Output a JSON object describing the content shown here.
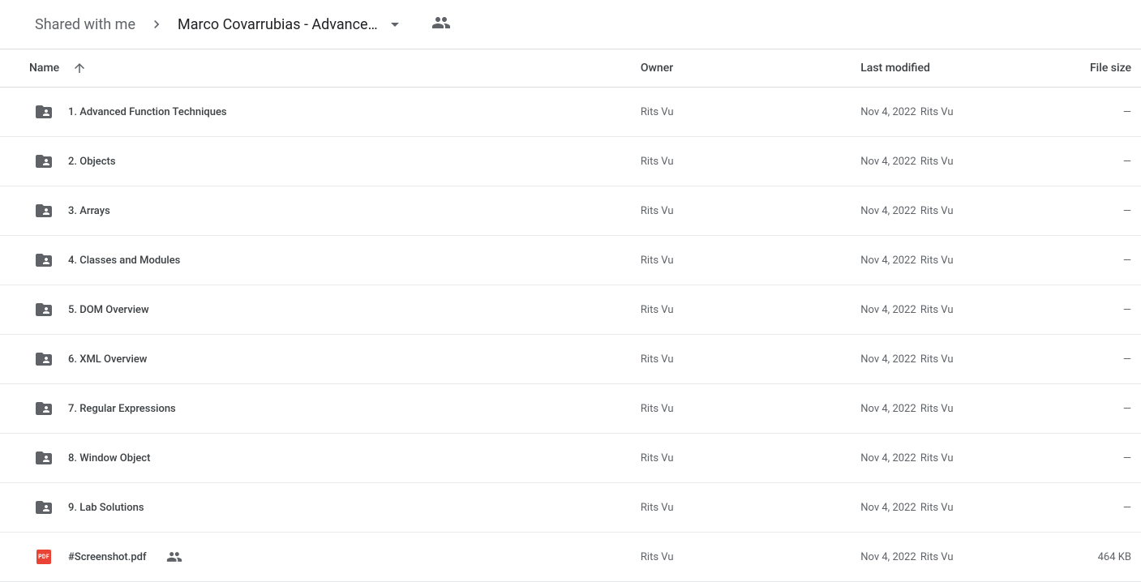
{
  "breadcrumb": {
    "root": "Shared with me",
    "current": "Marco Covarrubias - Advance…"
  },
  "columns": {
    "name": "Name",
    "owner": "Owner",
    "modified": "Last modified",
    "size": "File size"
  },
  "rows": [
    {
      "type": "folder-shared",
      "name": "1. Advanced Function Techniques",
      "owner": "Rits Vu",
      "modified_date": "Nov 4, 2022",
      "modified_by": "Rits Vu",
      "size": "—",
      "shared_badge": false
    },
    {
      "type": "folder-shared",
      "name": "2. Objects",
      "owner": "Rits Vu",
      "modified_date": "Nov 4, 2022",
      "modified_by": "Rits Vu",
      "size": "—",
      "shared_badge": false
    },
    {
      "type": "folder-shared",
      "name": "3. Arrays",
      "owner": "Rits Vu",
      "modified_date": "Nov 4, 2022",
      "modified_by": "Rits Vu",
      "size": "—",
      "shared_badge": false
    },
    {
      "type": "folder-shared",
      "name": "4. Classes and Modules",
      "owner": "Rits Vu",
      "modified_date": "Nov 4, 2022",
      "modified_by": "Rits Vu",
      "size": "—",
      "shared_badge": false
    },
    {
      "type": "folder-shared",
      "name": "5. DOM Overview",
      "owner": "Rits Vu",
      "modified_date": "Nov 4, 2022",
      "modified_by": "Rits Vu",
      "size": "—",
      "shared_badge": false
    },
    {
      "type": "folder-shared",
      "name": "6. XML Overview",
      "owner": "Rits Vu",
      "modified_date": "Nov 4, 2022",
      "modified_by": "Rits Vu",
      "size": "—",
      "shared_badge": false
    },
    {
      "type": "folder-shared",
      "name": "7. Regular Expressions",
      "owner": "Rits Vu",
      "modified_date": "Nov 4, 2022",
      "modified_by": "Rits Vu",
      "size": "—",
      "shared_badge": false
    },
    {
      "type": "folder-shared",
      "name": "8. Window Object",
      "owner": "Rits Vu",
      "modified_date": "Nov 4, 2022",
      "modified_by": "Rits Vu",
      "size": "—",
      "shared_badge": false
    },
    {
      "type": "folder-shared",
      "name": "9. Lab Solutions",
      "owner": "Rits Vu",
      "modified_date": "Nov 4, 2022",
      "modified_by": "Rits Vu",
      "size": "—",
      "shared_badge": false
    },
    {
      "type": "pdf",
      "name": "#Screenshot.pdf",
      "owner": "Rits Vu",
      "modified_date": "Nov 4, 2022",
      "modified_by": "Rits Vu",
      "size": "464 KB",
      "shared_badge": true
    }
  ],
  "icons": {
    "pdf_label": "PDF"
  }
}
